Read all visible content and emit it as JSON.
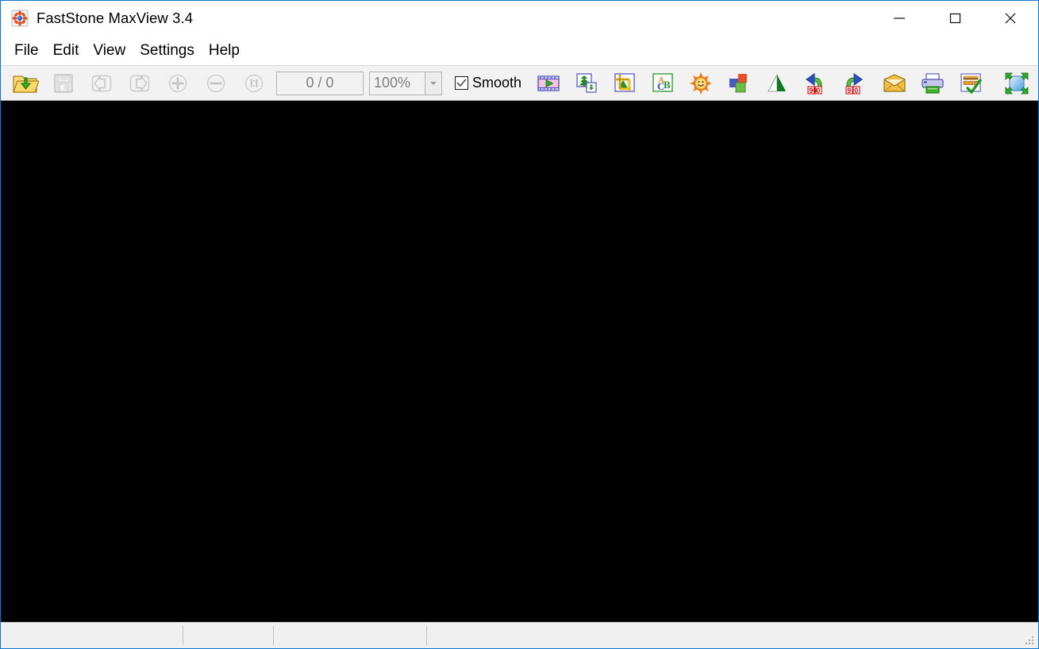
{
  "window": {
    "title": "FastStone MaxView 3.4",
    "app_icon": "faststone-flower-icon",
    "border_color": "#0a78d2",
    "canvas_color": "#000000"
  },
  "caption_buttons": [
    {
      "name": "minimize-button",
      "icon": "minimize-icon",
      "label": "—"
    },
    {
      "name": "maximize-button",
      "icon": "maximize-icon",
      "label": "□"
    },
    {
      "name": "close-button",
      "icon": "close-icon",
      "label": "✕"
    }
  ],
  "menubar": {
    "items": [
      {
        "label": "File"
      },
      {
        "label": "Edit"
      },
      {
        "label": "View"
      },
      {
        "label": "Settings"
      },
      {
        "label": "Help"
      }
    ]
  },
  "toolbar": {
    "buttons": [
      {
        "name": "open-button",
        "icon": "open-folder-icon",
        "tooltip": "Open",
        "enabled": true
      },
      {
        "name": "save-button",
        "icon": "save-disk-icon",
        "tooltip": "Save As",
        "enabled": false
      },
      {
        "name": "previous-button",
        "icon": "arrow-left-icon",
        "tooltip": "Previous Image",
        "enabled": false
      },
      {
        "name": "next-button",
        "icon": "arrow-right-icon",
        "tooltip": "Next Image",
        "enabled": false
      },
      {
        "name": "zoom-in-button",
        "icon": "zoom-in-icon",
        "tooltip": "Zoom In",
        "enabled": false
      },
      {
        "name": "zoom-out-button",
        "icon": "zoom-out-icon",
        "tooltip": "Zoom Out",
        "enabled": false
      },
      {
        "name": "actual-size-button",
        "icon": "one-to-one-icon",
        "tooltip": "Actual Size",
        "enabled": false
      }
    ],
    "page_counter": {
      "name": "page-counter",
      "value": "0 / 0"
    },
    "zoom": {
      "name": "zoom-level-field",
      "value": "100%",
      "dropdown_icon": "chevron-down-icon",
      "options": [
        "100%"
      ]
    },
    "smooth": {
      "name": "smooth-checkbox",
      "label": "Smooth",
      "checked": true
    },
    "tools": [
      {
        "name": "slideshow-button",
        "icon": "filmstrip-play-icon",
        "tooltip": "Slide Show"
      },
      {
        "name": "resize-button",
        "icon": "resize-resample-icon",
        "tooltip": "Resize / Resample"
      },
      {
        "name": "crop-button",
        "icon": "crop-icon",
        "tooltip": "Crop"
      },
      {
        "name": "text-button",
        "icon": "draw-text-icon",
        "tooltip": "Draw Board"
      },
      {
        "name": "brightness-button",
        "icon": "sun-icon",
        "tooltip": "Adjust Lighting"
      },
      {
        "name": "colors-button",
        "icon": "color-squares-icon",
        "tooltip": "Adjust Colors"
      },
      {
        "name": "flip-button",
        "icon": "flip-triangle-icon",
        "tooltip": "Flip / Mirror"
      },
      {
        "name": "rotate-left-button",
        "icon": "rotate-left-90-icon",
        "tooltip": "Rotate Left 90"
      },
      {
        "name": "rotate-right-button",
        "icon": "rotate-right-90-icon",
        "tooltip": "Rotate Right 90"
      },
      {
        "name": "email-button",
        "icon": "envelope-icon",
        "tooltip": "E-mail"
      },
      {
        "name": "print-button",
        "icon": "printer-icon",
        "tooltip": "Print"
      },
      {
        "name": "settings-button",
        "icon": "properties-check-icon",
        "tooltip": "Settings"
      },
      {
        "name": "fullscreen-button",
        "icon": "fullscreen-arrows-icon",
        "tooltip": "Full Screen"
      }
    ],
    "rotate_badge": "90"
  },
  "statusbar": {
    "panels": [
      {
        "name": "status-panel-filename",
        "text": ""
      },
      {
        "name": "status-panel-dimensions",
        "text": ""
      },
      {
        "name": "status-panel-filesize",
        "text": ""
      },
      {
        "name": "status-panel-info",
        "text": ""
      }
    ],
    "grip_icon": "resize-grip-icon"
  }
}
